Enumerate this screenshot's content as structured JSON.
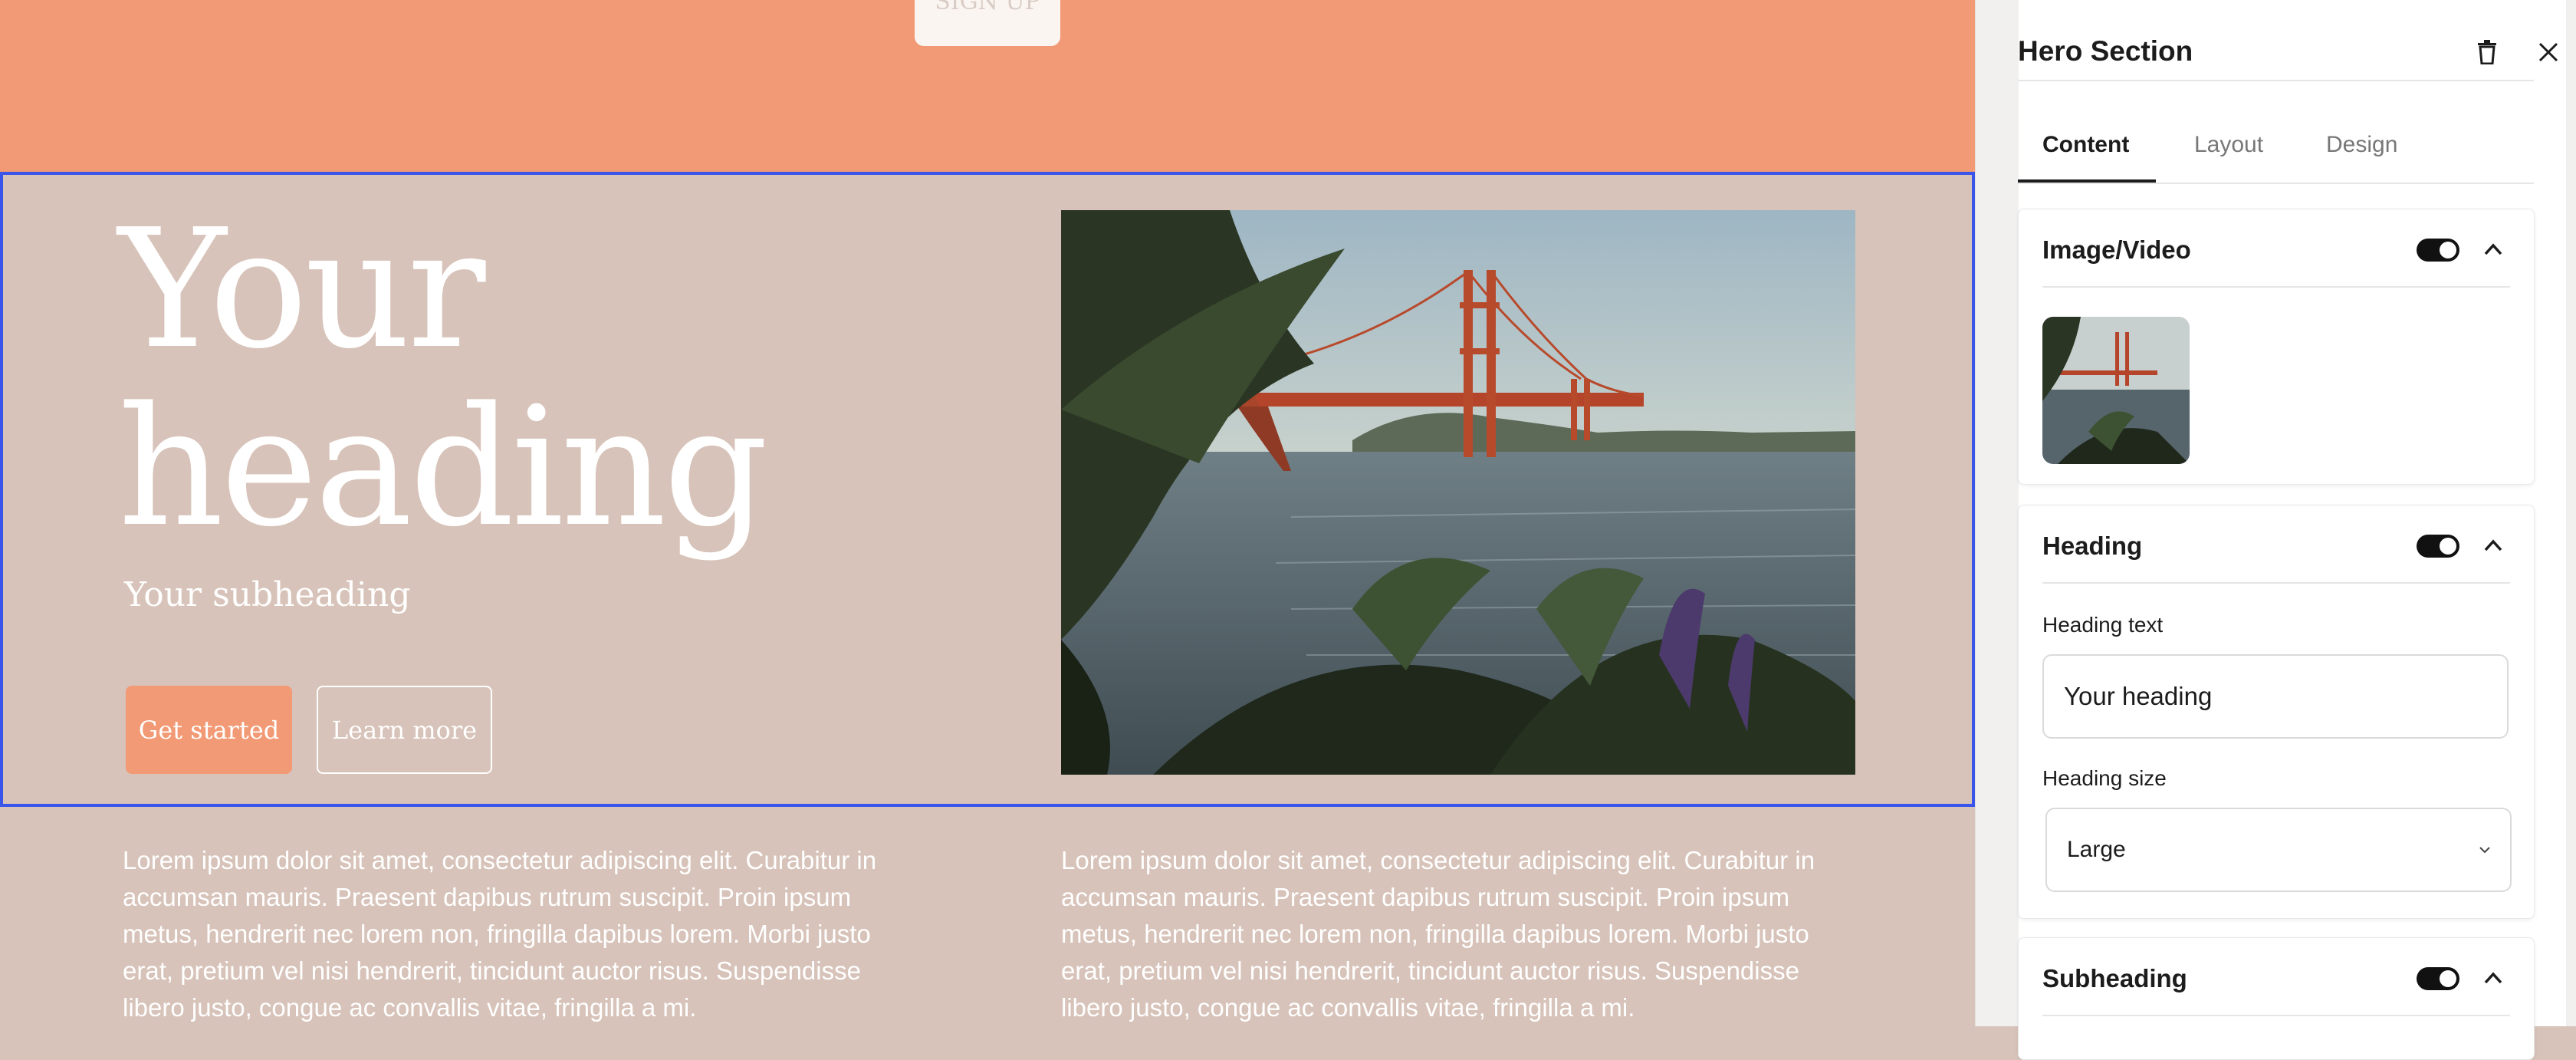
{
  "canvas": {
    "signup_label": "SIGN UP",
    "hero": {
      "heading": "Your heading",
      "subheading": "Your subheading",
      "primary_button": "Get started",
      "secondary_button": "Learn more"
    },
    "columns": [
      {
        "text": "Lorem ipsum dolor sit amet, consectetur adipiscing elit. Curabitur in accumsan mauris. Praesent dapibus rutrum suscipit. Proin ipsum metus, hendrerit nec lorem non, fringilla dapibus lorem. Morbi justo erat, pretium vel nisi hendrerit, tincidunt auctor risus. Suspendisse libero justo, congue ac convallis vitae, fringilla a mi."
      },
      {
        "text": "Lorem ipsum dolor sit amet, consectetur adipiscing elit. Curabitur in accumsan mauris. Praesent dapibus rutrum suscipit. Proin ipsum metus, hendrerit nec lorem non, fringilla dapibus lorem. Morbi justo erat, pretium vel nisi hendrerit, tincidunt auctor risus. Suspendisse libero justo, congue ac convallis vitae, fringilla a mi."
      }
    ]
  },
  "panel": {
    "title": "Hero Section",
    "tabs": [
      "Content",
      "Layout",
      "Design"
    ],
    "active_tab": "Content",
    "sections": {
      "image": {
        "title": "Image/Video",
        "enabled": true
      },
      "heading": {
        "title": "Heading",
        "enabled": true,
        "text_label": "Heading text",
        "text_value": "Your heading",
        "size_label": "Heading size",
        "size_value": "Large"
      },
      "subheading": {
        "title": "Subheading",
        "enabled": true
      }
    }
  },
  "colors": {
    "canvas_bg": "#d7c3b9",
    "accent": "#f29a75",
    "selection": "#3a55ea",
    "panel_bg": "#ffffff",
    "text_dark": "#1c1c1c"
  },
  "icons": [
    "trash-icon",
    "close-icon",
    "chevron-up-icon",
    "chevron-down-icon",
    "toggle-switch"
  ]
}
